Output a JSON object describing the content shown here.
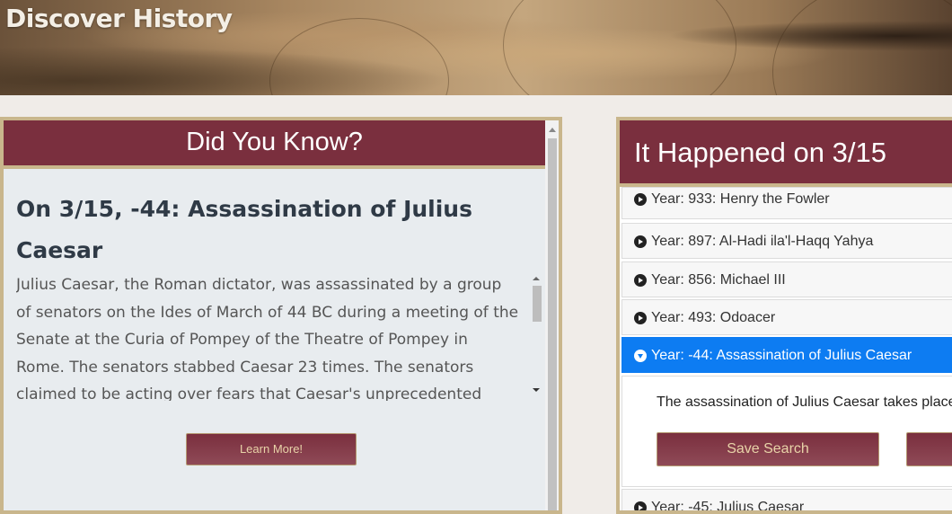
{
  "header": {
    "title": "Discover History"
  },
  "did_you_know": {
    "heading": "Did You Know?",
    "fact_title": "On 3/15, -44: Assassination of Julius Caesar",
    "fact_body": "Julius Caesar, the Roman dictator, was assassinated by a group of senators on the Ides of March of 44 BC during a meeting of the Senate at the Curia of Pompey of the Theatre of Pompey in Rome. The senators stabbed Caesar 23 times. The senators claimed to be acting over fears that Caesar's unprecedented",
    "learn_more_label": "Learn More!"
  },
  "happened_on": {
    "heading": "It Happened on 3/15",
    "items": [
      {
        "label": "Year: 933: Henry the Fowler",
        "active": false
      },
      {
        "label": "Year: 897: Al-Hadi ila'l-Haqq Yahya",
        "active": false
      },
      {
        "label": "Year: 856: Michael III",
        "active": false
      },
      {
        "label": "Year: 493: Odoacer",
        "active": false
      },
      {
        "label": "Year: -44: Assassination of Julius Caesar",
        "active": true
      },
      {
        "label": "Year: -45: Julius Caesar",
        "active": false
      }
    ],
    "expanded_text": "The assassination of Julius Caesar takes place",
    "save_search_label": "Save Search"
  },
  "colors": {
    "accent_maroon": "#7a2f3e",
    "border_gold": "#c9b68c",
    "active_blue": "#0d7cf2",
    "button_text": "#e8d3a8"
  }
}
